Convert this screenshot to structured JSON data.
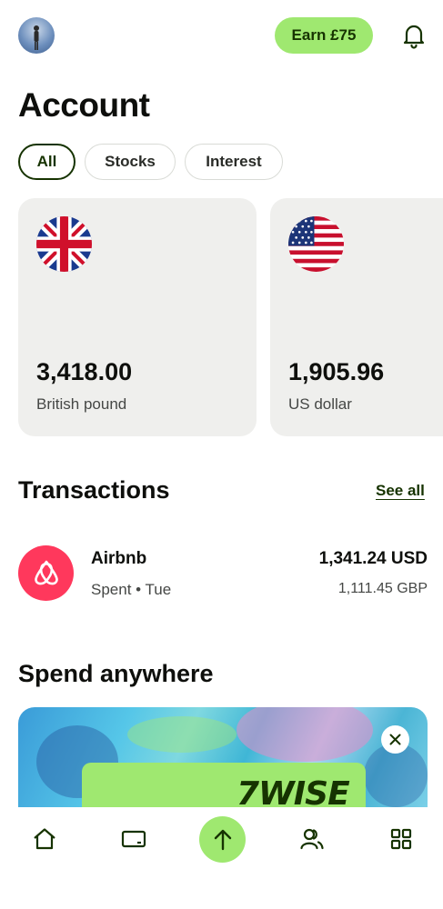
{
  "header": {
    "avatar_icon": "profile-avatar",
    "earn_label": "Earn £75",
    "notifications_icon": "bell-icon"
  },
  "page": {
    "title": "Account"
  },
  "filters": {
    "items": [
      "All",
      "Stocks",
      "Interest"
    ],
    "active": "All"
  },
  "balances": [
    {
      "flag_icon": "uk-flag",
      "amount": "3,418.00",
      "currency": "British pound"
    },
    {
      "flag_icon": "us-flag",
      "amount": "1,905.96",
      "currency": "US dollar"
    }
  ],
  "transactions": {
    "title": "Transactions",
    "see_all": "See all",
    "items": [
      {
        "logo_icon": "airbnb-logo",
        "name": "Airbnb",
        "meta": "Spent • Tue",
        "amount": "1,341.24 USD",
        "amount_secondary": "1,111.45 GBP"
      }
    ]
  },
  "promo": {
    "title": "Spend anywhere",
    "brand": "7WISE",
    "close_icon": "close-icon"
  },
  "nav": {
    "items": [
      "home-icon",
      "card-icon",
      "send-arrow-icon",
      "recipients-icon",
      "grid-icon"
    ]
  },
  "colors": {
    "accent": "#9fe870",
    "forest": "#163300",
    "card_bg": "#efefed",
    "airbnb": "#ff385c"
  }
}
